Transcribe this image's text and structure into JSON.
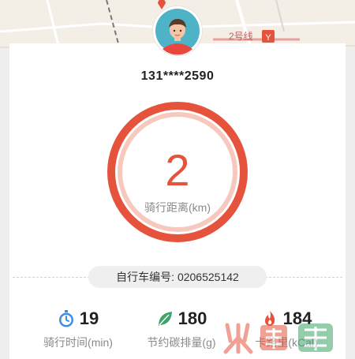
{
  "user": {
    "phone": "131****2590"
  },
  "ride": {
    "distance_value": "2",
    "distance_label": "骑行距离(km)",
    "bike_number_text": "自行车编号: 0206525142"
  },
  "stats": [
    {
      "icon": "stopwatch-icon",
      "value": "19",
      "label": "骑行时间(min)",
      "color": "#3a8ee6"
    },
    {
      "icon": "leaf-icon",
      "value": "180",
      "label": "节约碳排量(g)",
      "color": "#3fa36a"
    },
    {
      "icon": "flame-icon",
      "value": "184",
      "label": "卡路里(kCal)",
      "color": "#e5533d"
    }
  ],
  "map": {
    "route_label": "2号线"
  },
  "colors": {
    "accent": "#e5533d",
    "ring_light": "#f7c8bd"
  }
}
